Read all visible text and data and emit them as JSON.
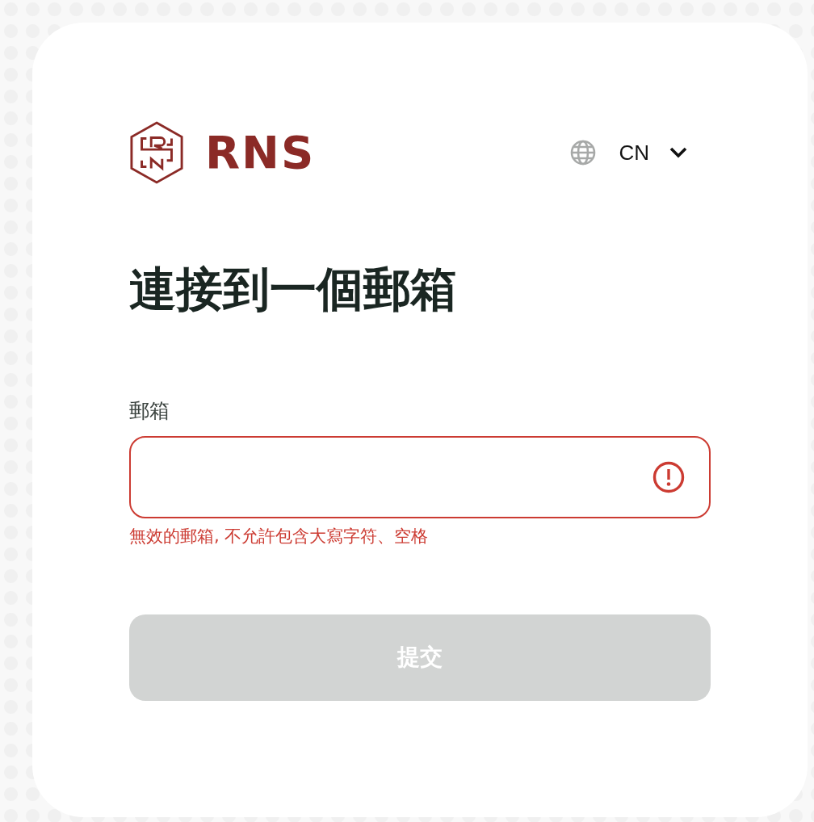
{
  "brand": {
    "name": "RNS"
  },
  "language": {
    "value": "CN"
  },
  "title": "連接到一個郵箱",
  "email_field": {
    "label": "郵箱",
    "invalid": true,
    "error": "無效的郵箱, 不允許包含大寫字符、空格"
  },
  "submit": {
    "label": "提交",
    "disabled": true
  }
}
